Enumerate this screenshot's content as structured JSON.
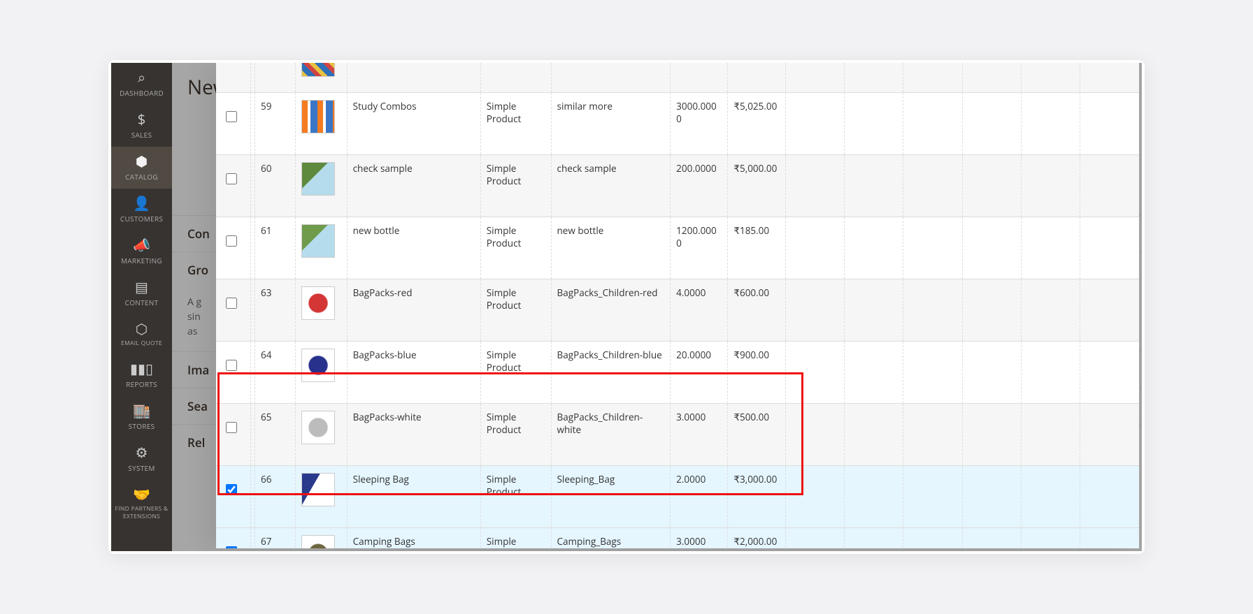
{
  "nav": {
    "items": [
      {
        "icon": "⌕",
        "label": "DASHBOARD"
      },
      {
        "icon": "$",
        "label": "SALES"
      },
      {
        "icon": "⬢",
        "label": "CATALOG",
        "active": true
      },
      {
        "icon": "👤",
        "label": "CUSTOMERS"
      },
      {
        "icon": "📣",
        "label": "MARKETING"
      },
      {
        "icon": "▤",
        "label": "CONTENT"
      },
      {
        "icon": "⬡",
        "label": "EMAIL QUOTE"
      },
      {
        "icon": "▮▮▯",
        "label": "REPORTS"
      },
      {
        "icon": "🏬",
        "label": "STORES"
      },
      {
        "icon": "⚙",
        "label": "SYSTEM"
      },
      {
        "icon": "🤝",
        "label": "FIND PARTNERS & EXTENSIONS"
      }
    ]
  },
  "backpage": {
    "title_fragment": "New",
    "sections": {
      "con": "Con",
      "gro": "Gro",
      "desc1": "A g",
      "desc2": "sin",
      "desc3": "as",
      "ima": "Ima",
      "sea": "Sea",
      "rel": "Rel"
    }
  },
  "table": {
    "rows": [
      {
        "checked": false,
        "id": "",
        "name": "",
        "type": "",
        "sku": "",
        "qty": "",
        "price": "",
        "thumb": "th-top",
        "stub": true
      },
      {
        "checked": false,
        "id": "59",
        "name": "Study Combos",
        "type": "Simple Product",
        "sku": "similar more",
        "qty": "3000.0000",
        "price": "₹5,025.00",
        "thumb": "th-combo"
      },
      {
        "checked": false,
        "id": "60",
        "name": "check sample",
        "type": "Simple Product",
        "sku": "check sample",
        "qty": "200.0000",
        "price": "₹5,000.00",
        "thumb": "th-photo1"
      },
      {
        "checked": false,
        "id": "61",
        "name": "new bottle",
        "type": "Simple Product",
        "sku": "new bottle",
        "qty": "1200.0000",
        "price": "₹185.00",
        "thumb": "th-photo2"
      },
      {
        "checked": false,
        "id": "63",
        "name": "BagPacks-red",
        "type": "Simple Product",
        "sku": "BagPacks_Children-red",
        "qty": "4.0000",
        "price": "₹600.00",
        "thumb": "th-bag-red"
      },
      {
        "checked": false,
        "id": "64",
        "name": "BagPacks-blue",
        "type": "Simple Product",
        "sku": "BagPacks_Children-blue",
        "qty": "20.0000",
        "price": "₹900.00",
        "thumb": "th-bag-blue"
      },
      {
        "checked": false,
        "id": "65",
        "name": "BagPacks-white",
        "type": "Simple Product",
        "sku": "BagPacks_Children-white",
        "qty": "3.0000",
        "price": "₹500.00",
        "thumb": "th-bag-white"
      },
      {
        "checked": true,
        "id": "66",
        "name": "Sleeping Bag",
        "type": "Simple Product",
        "sku": "Sleeping_Bag",
        "qty": "2.0000",
        "price": "₹3,000.00",
        "thumb": "th-sleep"
      },
      {
        "checked": true,
        "id": "67",
        "name": "Camping Bags",
        "type": "Simple Product",
        "sku": "Camping_Bags",
        "qty": "3.0000",
        "price": "₹2,000.00",
        "thumb": "th-camp"
      }
    ]
  }
}
